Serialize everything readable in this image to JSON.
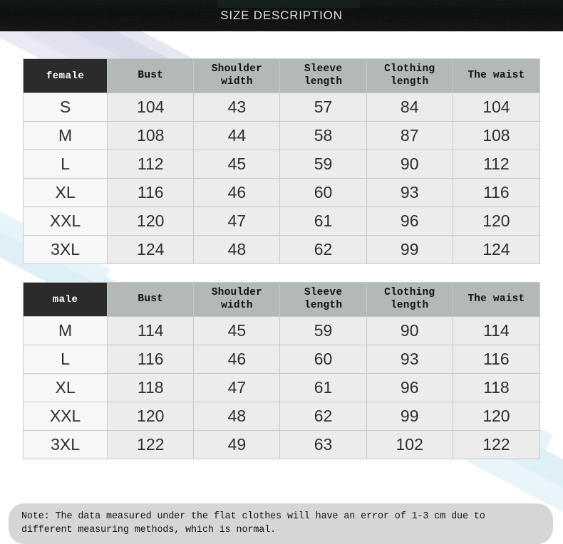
{
  "banner": {
    "title": "SIZE DESCRIPTION"
  },
  "colors": {
    "banner_bg": "#0c100d",
    "banner_text": "#dfe2df",
    "category_header_bg": "#2b2b2b",
    "category_header_text": "#ffffff",
    "column_header_bg": "#b3b9b7",
    "size_cell_bg": "#f7f7f7",
    "value_cell_bg": "#ececec",
    "cell_text": "#2e2e2e",
    "border": "#c8c8c8",
    "note_bg": "#d6d6d6",
    "accent_lavender": "#c9cbe0",
    "accent_blue": "#d7ecf7"
  },
  "tables": [
    {
      "id": "female",
      "category_label": "female",
      "columns": [
        "Bust",
        "Shoulder width",
        "Sleeve length",
        "Clothing length",
        "The waist"
      ],
      "column_lines": [
        [
          "Bust"
        ],
        [
          "Shoulder",
          "width"
        ],
        [
          "Sleeve",
          "length"
        ],
        [
          "Clothing",
          "length"
        ],
        [
          "The waist"
        ]
      ],
      "rows": [
        {
          "size": "S",
          "values": [
            "104",
            "43",
            "57",
            "84",
            "104"
          ]
        },
        {
          "size": "M",
          "values": [
            "108",
            "44",
            "58",
            "87",
            "108"
          ]
        },
        {
          "size": "L",
          "values": [
            "112",
            "45",
            "59",
            "90",
            "112"
          ]
        },
        {
          "size": "XL",
          "values": [
            "116",
            "46",
            "60",
            "93",
            "116"
          ]
        },
        {
          "size": "XXL",
          "values": [
            "120",
            "47",
            "61",
            "96",
            "120"
          ]
        },
        {
          "size": "3XL",
          "values": [
            "124",
            "48",
            "62",
            "99",
            "124"
          ]
        }
      ]
    },
    {
      "id": "male",
      "category_label": "male",
      "columns": [
        "Bust",
        "Shoulder width",
        "Sleeve length",
        "Clothing length",
        "The waist"
      ],
      "column_lines": [
        [
          "Bust"
        ],
        [
          "Shoulder",
          "width"
        ],
        [
          "Sleeve",
          "length"
        ],
        [
          "Clothing",
          "length"
        ],
        [
          "The waist"
        ]
      ],
      "rows": [
        {
          "size": "M",
          "values": [
            "114",
            "45",
            "59",
            "90",
            "114"
          ]
        },
        {
          "size": "L",
          "values": [
            "116",
            "46",
            "60",
            "93",
            "116"
          ]
        },
        {
          "size": "XL",
          "values": [
            "118",
            "47",
            "61",
            "96",
            "118"
          ]
        },
        {
          "size": "XXL",
          "values": [
            "120",
            "48",
            "62",
            "99",
            "120"
          ]
        },
        {
          "size": "3XL",
          "values": [
            "122",
            "49",
            "63",
            "102",
            "122"
          ]
        }
      ]
    }
  ],
  "note": {
    "line1": "Note: The data measured under the flat clothes will have an error of 1-3 cm due to",
    "line2": " different measuring methods, which is normal."
  }
}
